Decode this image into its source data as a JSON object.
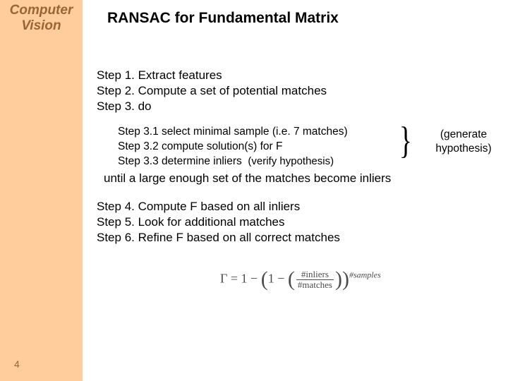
{
  "sidebar": {
    "line1": "Computer",
    "line2": "Vision",
    "page": "4"
  },
  "title": "RANSAC for Fundamental Matrix",
  "steps": {
    "s1": "Step 1. Extract features",
    "s2": "Step 2. Compute a set of potential matches",
    "s3": "Step 3. do",
    "s31": "Step 3.1 select minimal sample (i.e. 7 matches)",
    "s32": "Step 3.2 compute solution(s) for F",
    "s33a": "Step 3.3 determine inliers",
    "s33b": "(verify hypothesis)",
    "until": "until a large enough set of the matches become inliers",
    "s4": "Step 4. Compute F based on all inliers",
    "s5": "Step 5. Look for additional matches",
    "s6": "Step 6. Refine F based on all correct matches"
  },
  "annotation": {
    "line1": "(generate",
    "line2": "hypothesis)"
  },
  "formula": {
    "gamma": "Γ",
    "eq": " = 1 − ",
    "lp1": "(",
    "one_minus": "1 − ",
    "lp2": "(",
    "num": "#inliers",
    "den": "#matches",
    "rp2": ")",
    "rp1": ")",
    "exp": "#samples"
  }
}
